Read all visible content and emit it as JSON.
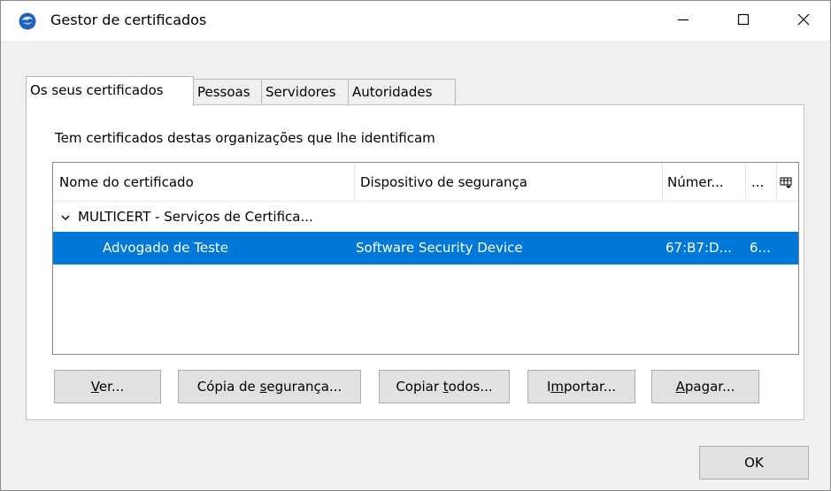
{
  "window": {
    "title": "Gestor de certificados"
  },
  "tabs": [
    {
      "label": "Os seus certificados"
    },
    {
      "label": "Pessoas"
    },
    {
      "label": "Servidores"
    },
    {
      "label": "Autoridades"
    }
  ],
  "panel": {
    "description": "Tem certificados destas organizações que lhe identificam",
    "columns": [
      {
        "label": "Nome do certificado"
      },
      {
        "label": "Dispositivo de segurança"
      },
      {
        "label": "Númer..."
      },
      {
        "label": "..."
      }
    ],
    "group": {
      "label": "MULTICERT - Serviços de Certifica..."
    },
    "selected_row": {
      "name": "Advogado de Teste",
      "device": "Software Security Device",
      "serial": "67:B7:D...",
      "extra": "6..."
    },
    "buttons": {
      "view": {
        "accel": "V",
        "rest": "er..."
      },
      "backup": {
        "pre": "Cópia de ",
        "accel": "s",
        "rest": "egurança..."
      },
      "backup_all": {
        "pre": "Copiar ",
        "accel": "t",
        "rest": "odos..."
      },
      "import": {
        "pre": "I",
        "accel": "m",
        "rest": "portar..."
      },
      "delete": {
        "accel": "A",
        "rest": "pagar..."
      }
    }
  },
  "footer": {
    "ok_label": "OK"
  },
  "colors": {
    "selection": "#0078d7",
    "button_face": "#e1e1e1"
  },
  "icons": [
    "thunderbird-app-icon",
    "minimize-icon",
    "maximize-icon",
    "close-icon",
    "chevron-down-icon",
    "column-picker-icon"
  ]
}
